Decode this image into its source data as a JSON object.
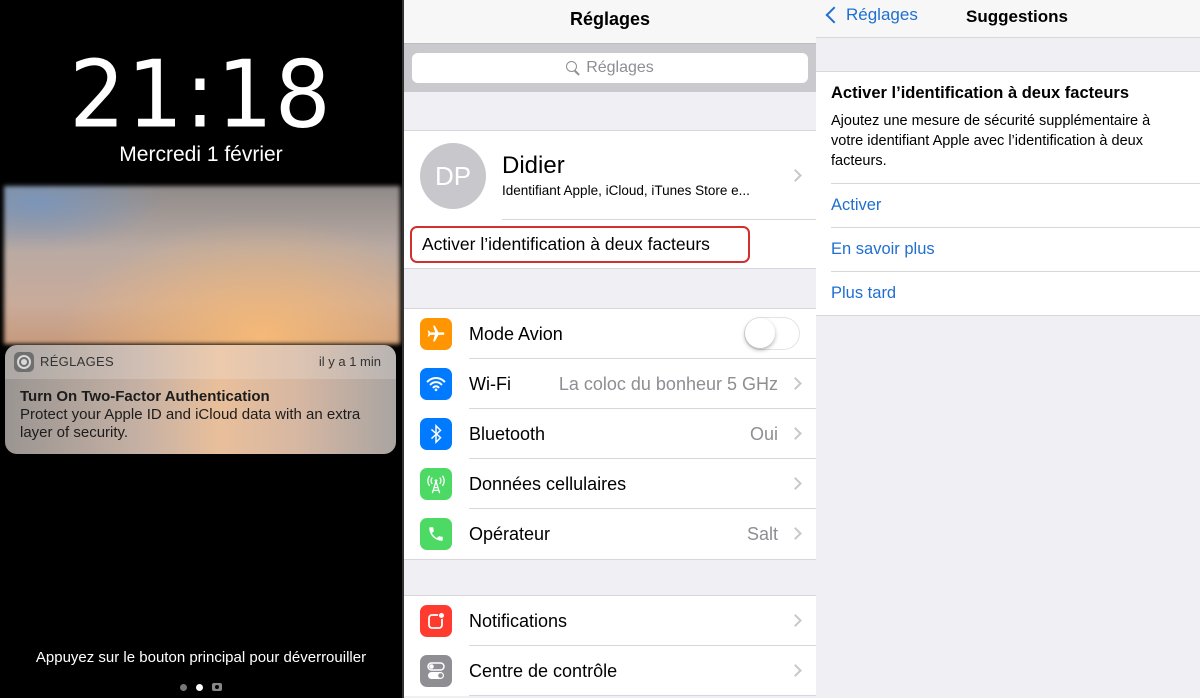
{
  "lock_screen": {
    "time": "21:18",
    "date": "Mercredi 1 février",
    "notification": {
      "app": "RÉGLAGES",
      "app_icon": "settings-gear-icon",
      "time_ago": "il y a 1 min",
      "title": "Turn On Two-Factor Authentication",
      "body": "Protect your Apple ID and iCloud data with an extra layer of security."
    },
    "unlock_hint": "Appuyez sur le bouton principal pour déverrouiller",
    "page_indicator": {
      "pages": 2,
      "current": 2,
      "has_camera": true
    }
  },
  "settings": {
    "title": "Réglages",
    "search_placeholder": "Réglages",
    "profile": {
      "initials": "DP",
      "name": "Didier",
      "subtitle": "Identifiant Apple, iCloud, iTunes Store e..."
    },
    "suggestion": "Activer l’identification à deux facteurs",
    "highlight_color": "#d0312d",
    "group1": [
      {
        "label": "Mode Avion",
        "icon": "airplane-icon",
        "color": "#ff9500",
        "toggle": false
      },
      {
        "label": "Wi-Fi",
        "icon": "wifi-icon",
        "color": "#007aff",
        "value": "La coloc du bonheur 5 GHz"
      },
      {
        "label": "Bluetooth",
        "icon": "bluetooth-icon",
        "color": "#007aff",
        "value": "Oui"
      },
      {
        "label": "Données cellulaires",
        "icon": "cellular-antenna-icon",
        "color": "#4cd964",
        "value": ""
      },
      {
        "label": "Opérateur",
        "icon": "phone-icon",
        "color": "#4cd964",
        "value": "Salt"
      }
    ],
    "group2": [
      {
        "label": "Notifications",
        "icon": "notifications-icon",
        "color": "#ff3b30",
        "value": ""
      },
      {
        "label": "Centre de contrôle",
        "icon": "control-center-icon",
        "color": "#8e8e93",
        "value": ""
      }
    ]
  },
  "suggestions": {
    "back_label": "Réglages",
    "title": "Suggestions",
    "card_title": "Activer l’identification à deux facteurs",
    "card_desc": "Ajoutez une mesure de sécurité supplémentaire à votre identifiant Apple avec l’identification à deux facteurs.",
    "actions": [
      "Activer",
      "En savoir plus",
      "Plus tard"
    ],
    "link_color": "#1f6fd1"
  }
}
